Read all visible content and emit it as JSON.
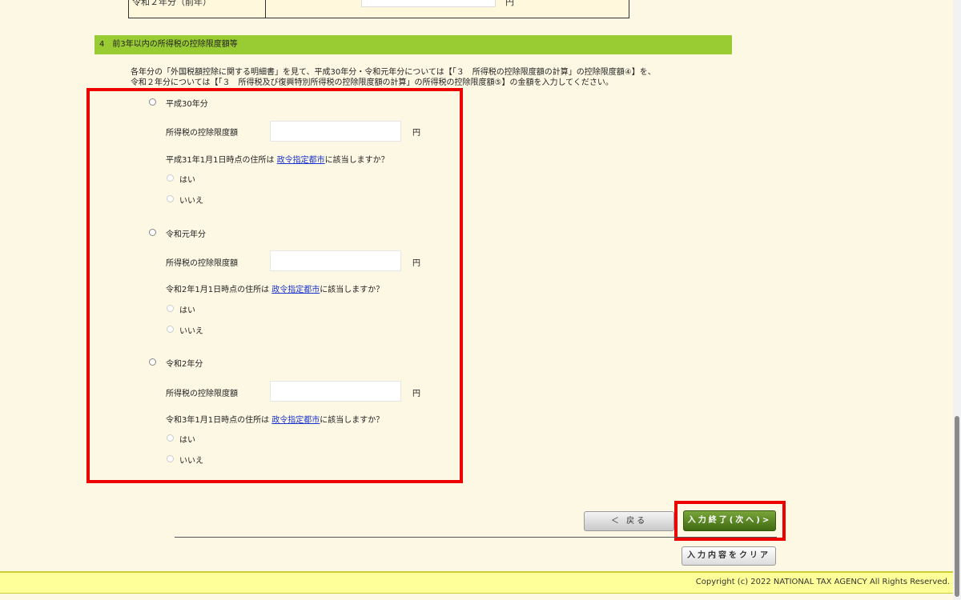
{
  "prev_row": {
    "label": "令和２年分（前年）",
    "unit": "円"
  },
  "section": {
    "title": "4　前3年以内の所得税の控除限度額等",
    "desc_line1": "各年分の「外国税額控除に関する明細書」を見て、平成30年分・令和元年分については【「３　所得税の控除限度額の計算」の控除限度額④】を、",
    "desc_line2": "令和２年分については【「３　所得税及び復興特別所得税の控除限度額の計算」の所得税の控除限度額⑤】の金額を入力してください。"
  },
  "years": [
    {
      "label": "平成30年分",
      "field_label": "所得税の控除限度額",
      "unit": "円",
      "question_pre": "平成31年1月1日時点の住所は",
      "question_link": "政令指定都市",
      "question_post": "に該当しますか？",
      "yes": "はい",
      "no": "いいえ"
    },
    {
      "label": "令和元年分",
      "field_label": "所得税の控除限度額",
      "unit": "円",
      "question_pre": "令和2年1月1日時点の住所は",
      "question_link": "政令指定都市",
      "question_post": "に該当しますか？",
      "yes": "はい",
      "no": "いいえ"
    },
    {
      "label": "令和2年分",
      "field_label": "所得税の控除限度額",
      "unit": "円",
      "question_pre": "令和3年1月1日時点の住所は",
      "question_link": "政令指定都市",
      "question_post": "に該当しますか？",
      "yes": "はい",
      "no": "いいえ"
    }
  ],
  "buttons": {
    "back": "＜ 戻る",
    "next": "入力終了(次へ)>",
    "clear": "入力内容をクリア"
  },
  "footer": {
    "copyright": "Copyright (c) 2022 NATIONAL TAX AGENCY All Rights Reserved."
  },
  "colors": {
    "section_bar": "#99cc33",
    "highlight": "#e00000",
    "footer": "#ffff99",
    "link": "#1a33cc"
  }
}
